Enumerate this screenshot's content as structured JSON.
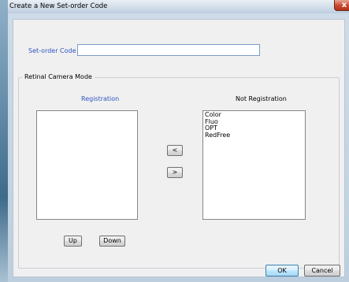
{
  "window": {
    "title": "Create a New Set-order Code",
    "close_glyph": "x"
  },
  "form": {
    "setorder_code_label": "Set-order Code",
    "setorder_code_value": ""
  },
  "group": {
    "title": "Retinal Camera Mode",
    "registration_header": "Registration",
    "not_registration_header": "Not Registration",
    "registration_items": [],
    "not_registration_items": [
      "Color",
      "Fluo",
      "OPT",
      "RedFree"
    ]
  },
  "buttons": {
    "move_left": "<",
    "move_right": ">",
    "up": "Up",
    "down": "Down",
    "ok": "OK",
    "cancel": "Cancel"
  },
  "colors": {
    "label_blue": "#2e55c0",
    "dialog_bg": "#f0f0f0",
    "close_red": "#c9482f"
  }
}
